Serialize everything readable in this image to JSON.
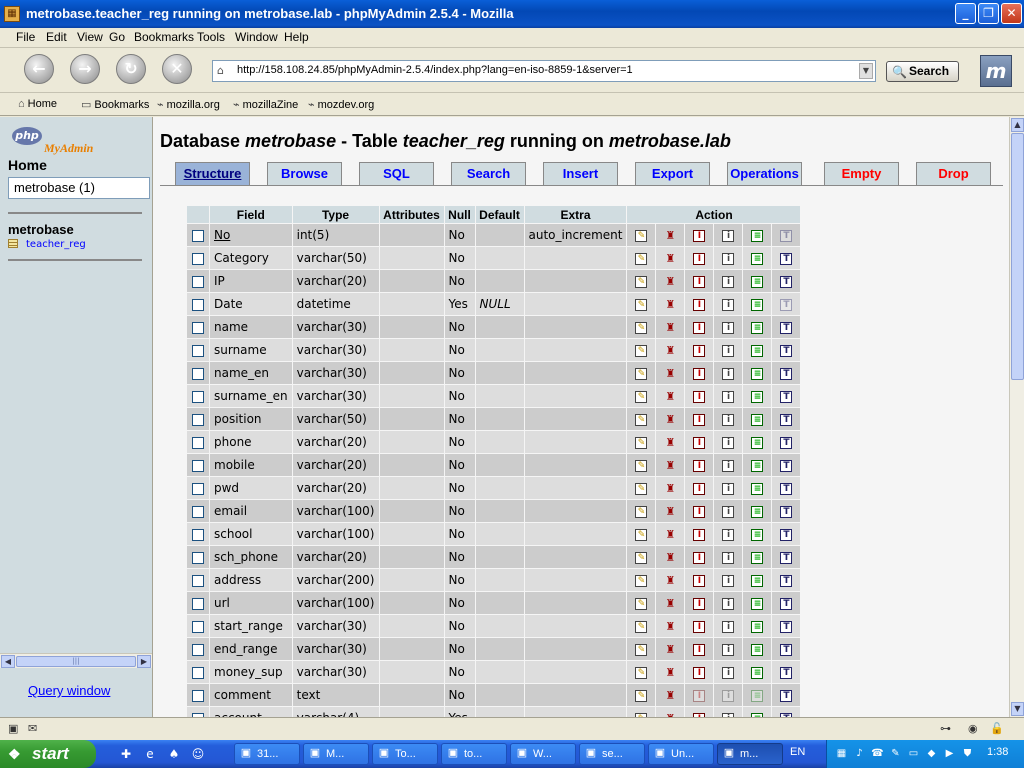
{
  "window": {
    "title": "metrobase.teacher_reg running on metrobase.lab - phpMyAdmin 2.5.4 - Mozilla",
    "app_icon": "phpmyadmin-icon"
  },
  "menu": [
    "File",
    "Edit",
    "View",
    "Go",
    "Bookmarks",
    "Tools",
    "Window",
    "Help"
  ],
  "nav": {
    "url": "http://158.108.24.85/phpMyAdmin-2.5.4/index.php?lang=en-iso-8859-1&server=1",
    "search_label": "Search"
  },
  "personal_toolbar": [
    "Home",
    "Bookmarks",
    "mozilla.org",
    "mozillaZine",
    "mozdev.org"
  ],
  "left_frame": {
    "logo_php": "php",
    "logo_my": "MyAdmin",
    "home": "Home",
    "db_select": "metrobase (1)",
    "db_name": "metrobase",
    "table_link": "teacher_reg",
    "query_window": "Query window"
  },
  "main": {
    "heading_prefix": "Database ",
    "heading_db": "metrobase",
    "heading_mid": " - Table ",
    "heading_table": "teacher_reg",
    "heading_mid2": " running on ",
    "heading_host": "metrobase.lab",
    "tabs": [
      "Structure",
      "Browse",
      "SQL",
      "Search",
      "Insert",
      "Export",
      "Operations",
      "Empty",
      "Drop"
    ],
    "active_tab": "Structure",
    "columns": [
      "Field",
      "Type",
      "Attributes",
      "Null",
      "Default",
      "Extra",
      "Action"
    ],
    "fields": [
      {
        "name": "No",
        "type": "int(5)",
        "null": "No",
        "default": "",
        "extra": "auto_increment",
        "primary": true,
        "ft_enabled": false
      },
      {
        "name": "Category",
        "type": "varchar(50)",
        "null": "No",
        "default": "",
        "extra": "",
        "ft_enabled": true
      },
      {
        "name": "IP",
        "type": "varchar(20)",
        "null": "No",
        "default": "",
        "extra": "",
        "ft_enabled": true
      },
      {
        "name": "Date",
        "type": "datetime",
        "null": "Yes",
        "default": "NULL",
        "extra": "",
        "ft_enabled": false
      },
      {
        "name": "name",
        "type": "varchar(30)",
        "null": "No",
        "default": "",
        "extra": "",
        "ft_enabled": true
      },
      {
        "name": "surname",
        "type": "varchar(30)",
        "null": "No",
        "default": "",
        "extra": "",
        "ft_enabled": true
      },
      {
        "name": "name_en",
        "type": "varchar(30)",
        "null": "No",
        "default": "",
        "extra": "",
        "ft_enabled": true
      },
      {
        "name": "surname_en",
        "type": "varchar(30)",
        "null": "No",
        "default": "",
        "extra": "",
        "ft_enabled": true
      },
      {
        "name": "position",
        "type": "varchar(50)",
        "null": "No",
        "default": "",
        "extra": "",
        "ft_enabled": true
      },
      {
        "name": "phone",
        "type": "varchar(20)",
        "null": "No",
        "default": "",
        "extra": "",
        "ft_enabled": true
      },
      {
        "name": "mobile",
        "type": "varchar(20)",
        "null": "No",
        "default": "",
        "extra": "",
        "ft_enabled": true
      },
      {
        "name": "pwd",
        "type": "varchar(20)",
        "null": "No",
        "default": "",
        "extra": "",
        "ft_enabled": true
      },
      {
        "name": "email",
        "type": "varchar(100)",
        "null": "No",
        "default": "",
        "extra": "",
        "ft_enabled": true
      },
      {
        "name": "school",
        "type": "varchar(100)",
        "null": "No",
        "default": "",
        "extra": "",
        "ft_enabled": true
      },
      {
        "name": "sch_phone",
        "type": "varchar(20)",
        "null": "No",
        "default": "",
        "extra": "",
        "ft_enabled": true
      },
      {
        "name": "address",
        "type": "varchar(200)",
        "null": "No",
        "default": "",
        "extra": "",
        "ft_enabled": true
      },
      {
        "name": "url",
        "type": "varchar(100)",
        "null": "No",
        "default": "",
        "extra": "",
        "ft_enabled": true
      },
      {
        "name": "start_range",
        "type": "varchar(30)",
        "null": "No",
        "default": "",
        "extra": "",
        "ft_enabled": true
      },
      {
        "name": "end_range",
        "type": "varchar(30)",
        "null": "No",
        "default": "",
        "extra": "",
        "ft_enabled": true
      },
      {
        "name": "money_sup",
        "type": "varchar(30)",
        "null": "No",
        "default": "",
        "extra": "",
        "ft_enabled": true
      },
      {
        "name": "comment",
        "type": "text",
        "null": "No",
        "default": "",
        "extra": "",
        "text_type": true,
        "ft_enabled": true
      },
      {
        "name": "account",
        "type": "varchar(4)",
        "null": "Yes",
        "default": "",
        "extra": "",
        "ft_enabled": true
      }
    ]
  },
  "taskbar": {
    "start": "start",
    "tasks": [
      {
        "label": "31...",
        "icon": "pencil-icon"
      },
      {
        "label": "M...",
        "icon": "music-icon"
      },
      {
        "label": "To...",
        "icon": "phpmyadmin-icon"
      },
      {
        "label": "to...",
        "icon": "folder-icon"
      },
      {
        "label": "W...",
        "icon": "web-icon"
      },
      {
        "label": "se...",
        "icon": "document-icon"
      },
      {
        "label": "Un...",
        "icon": "phpmyadmin-icon"
      },
      {
        "label": "m...",
        "icon": "phpmyadmin-icon",
        "active": true
      }
    ],
    "lang": "EN",
    "clock": "1:38"
  },
  "colors": {
    "tab_active_bg": "#9ab3d8",
    "row_odd": "#cccccc",
    "row_even": "#dddddd",
    "header_bg": "#d0dce0",
    "link": "#0000ff",
    "danger": "#ff0000"
  }
}
